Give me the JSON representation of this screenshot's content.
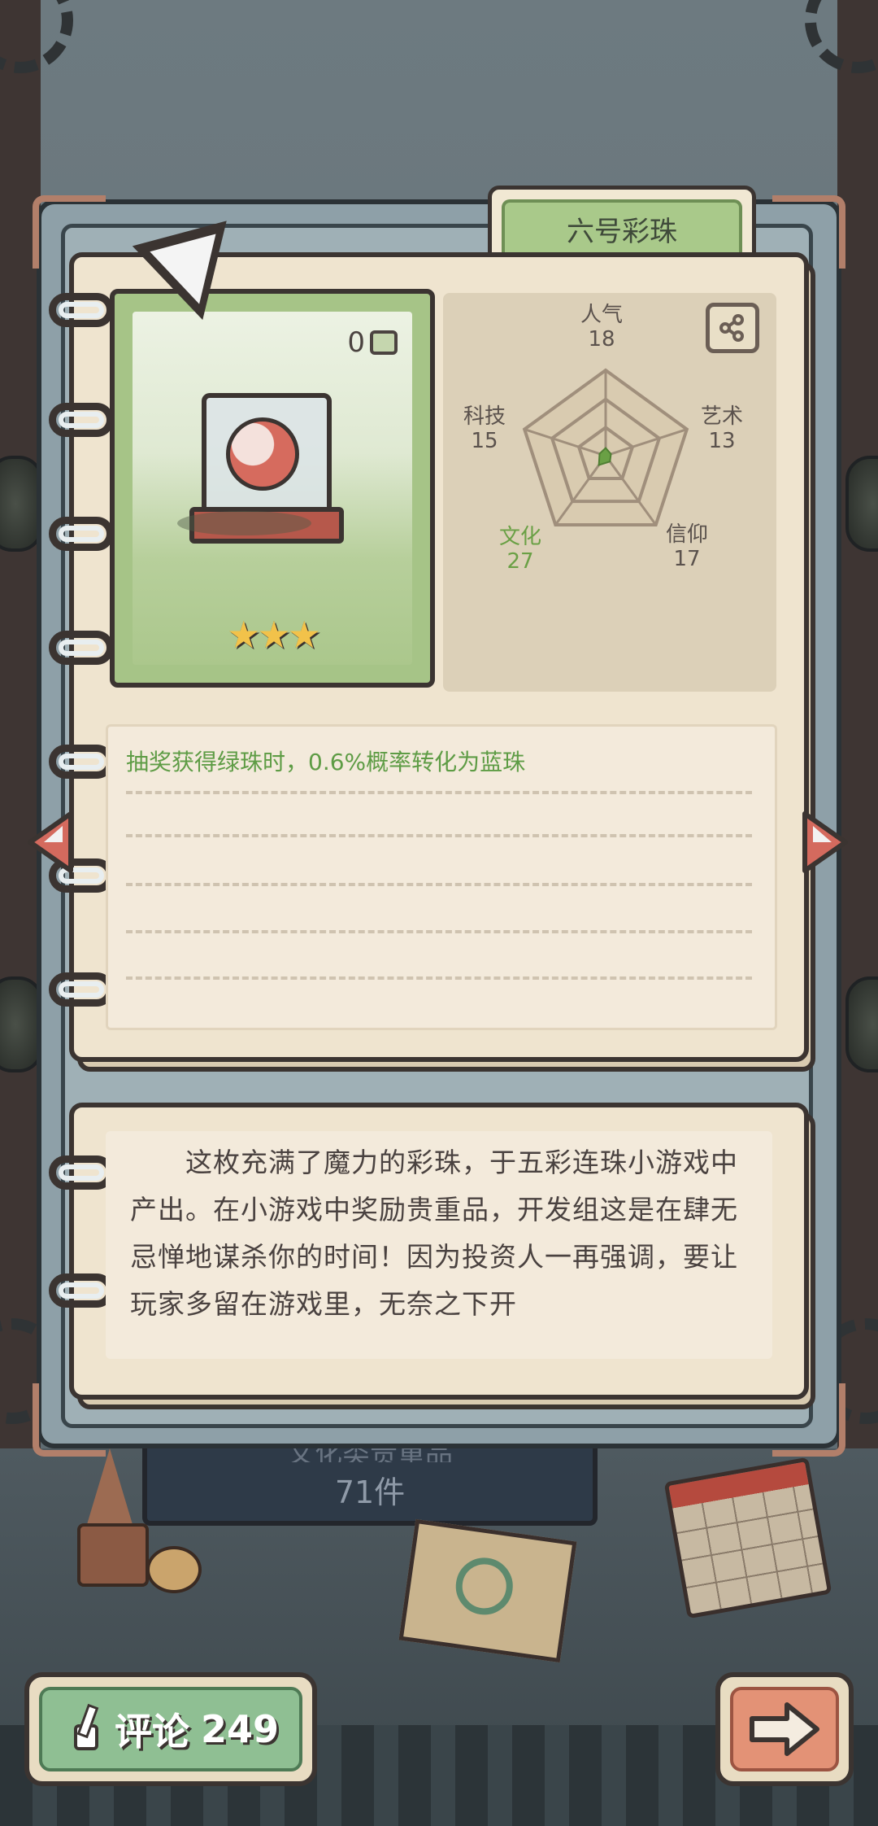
{
  "title": "六号彩珠",
  "card": {
    "fragment_count": "0",
    "stars": "★★★",
    "star_rating": 3
  },
  "stats": {
    "popularity": {
      "label": "人气",
      "value": "18"
    },
    "art": {
      "label": "艺术",
      "value": "13"
    },
    "faith": {
      "label": "信仰",
      "value": "17"
    },
    "culture": {
      "label": "文化",
      "value": "27"
    },
    "technology": {
      "label": "科技",
      "value": "15"
    }
  },
  "effect": "抽奖获得绿珠时，0.6%概率转化为蓝珠",
  "story": "这枚充满了魔力的彩珠，于五彩连珠小游戏中产出。在小游戏中奖励贵重品，开发组这是在肆无忌惮地谋杀你的时间！因为投资人一再强调，要让玩家多留在游戏里，无奈之下开",
  "background": {
    "plaque_line1": "文化类贵重品",
    "plaque_line2": "71件"
  },
  "buttons": {
    "comment_label": "评论",
    "comment_count": "249"
  },
  "colors": {
    "accent_green": "#6aa045",
    "page": "#efe4cf",
    "outline": "#3b3431"
  }
}
